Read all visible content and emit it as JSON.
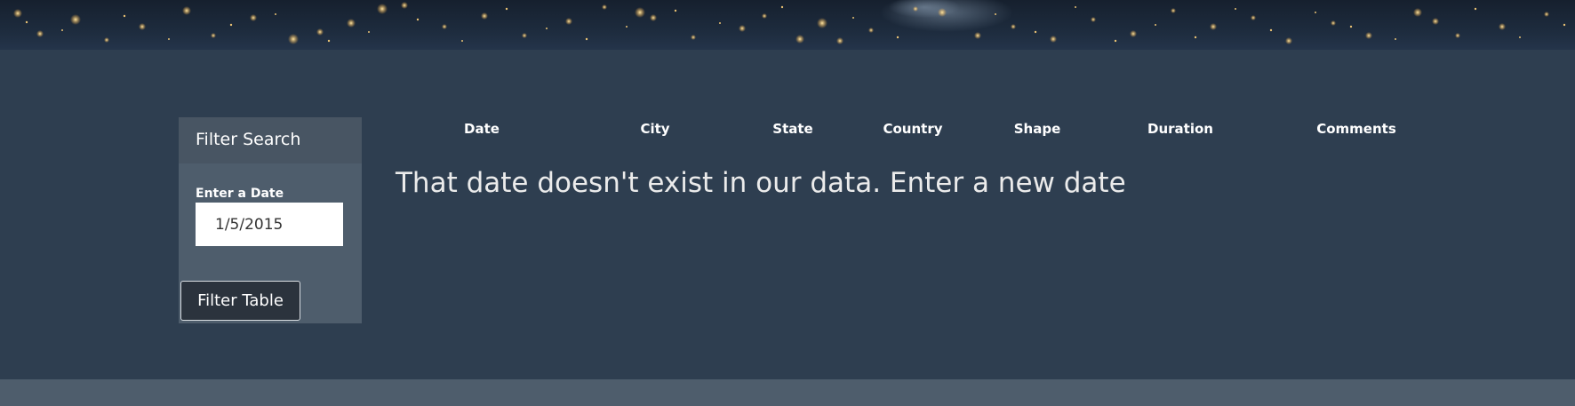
{
  "hero": {
    "description_icon": "city-lights-banner"
  },
  "filter": {
    "title": "Filter Search",
    "date_label": "Enter a Date",
    "date_value": "1/5/2015",
    "button_label": "Filter Table"
  },
  "table": {
    "columns": [
      "Date",
      "City",
      "State",
      "Country",
      "Shape",
      "Duration",
      "Comments"
    ],
    "message": "That date doesn't exist in our data. Enter a new date"
  },
  "colors": {
    "page_background": "#2e3e50",
    "panel_background": "#4e5d6c",
    "panel_header": "#485563",
    "button_background": "#2b333d",
    "footer_band": "#4e5d6c"
  }
}
